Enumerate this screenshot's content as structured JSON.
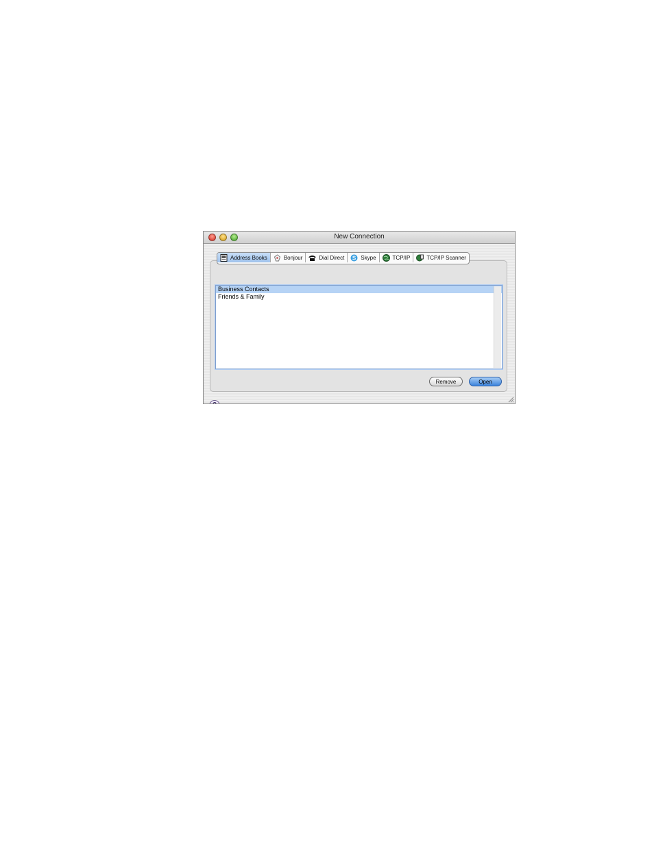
{
  "window": {
    "title": "New Connection"
  },
  "tabs": [
    {
      "label": "Address Books",
      "icon": "address-book-icon"
    },
    {
      "label": "Bonjour",
      "icon": "bonjour-icon"
    },
    {
      "label": "Dial Direct",
      "icon": "phone-icon"
    },
    {
      "label": "Skype",
      "icon": "skype-icon"
    },
    {
      "label": "TCP/IP",
      "icon": "globe-icon"
    },
    {
      "label": "TCP/IP Scanner",
      "icon": "globe-scanner-icon"
    }
  ],
  "active_tab": "Address Books",
  "list": {
    "items": [
      {
        "label": "Business Contacts",
        "selected": true
      },
      {
        "label": "Friends & Family",
        "selected": false
      }
    ]
  },
  "buttons": {
    "remove": "Remove",
    "open": "Open"
  },
  "help": {
    "label": "?"
  },
  "colors": {
    "selection": "#b6d3f5",
    "active_tab": "#a8c8ef",
    "default_button": "#3b83dc"
  }
}
